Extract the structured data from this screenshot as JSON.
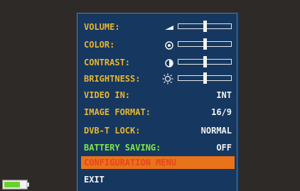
{
  "menu": {
    "volume": {
      "label": "VOLUME:",
      "icon": "speaker-ramp-icon",
      "level": 0.5
    },
    "color": {
      "label": "COLOR:",
      "icon": "color-circle-icon",
      "level": 0.5
    },
    "contrast": {
      "label": "CONTRAST:",
      "icon": "contrast-circle-icon",
      "level": 0.5
    },
    "brightness": {
      "label": "BRIGHTNESS:",
      "icon": "sun-icon",
      "level": 0.5
    },
    "video_in": {
      "label": "VIDEO IN:",
      "value": "INT"
    },
    "image_format": {
      "label": "IMAGE FORMAT:",
      "value": "16/9"
    },
    "dvbt_lock": {
      "label": "DVB-T LOCK:",
      "value": "NORMAL"
    },
    "battery_saving": {
      "label": "BATTERY SAVING:",
      "value": "OFF"
    },
    "configuration": {
      "label": "CONFIGURATION MENU"
    },
    "exit": {
      "label": "EXIT"
    }
  },
  "battery": {
    "icon": "battery-icon",
    "level": 0.7
  },
  "colors": {
    "background": "#2e2a28",
    "panel": "#163860",
    "label": "#e8b530",
    "green_label": "#7de64a",
    "highlight": "#e9731a",
    "highlight_text": "#e8451e",
    "value": "#f2f2f2"
  }
}
